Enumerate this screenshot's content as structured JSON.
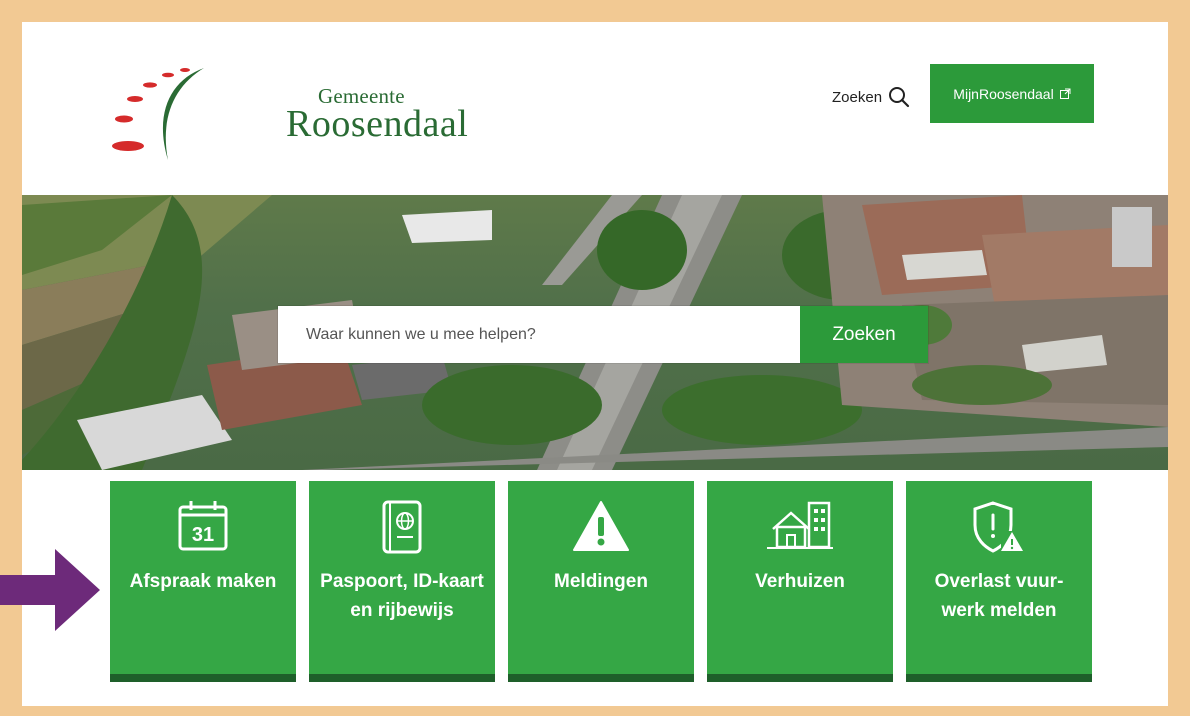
{
  "header": {
    "logo_small": "Gemeente",
    "logo_big": "Roosendaal",
    "search_label": "Zoeken",
    "mijn_label": "MijnRoosendaal"
  },
  "hero": {
    "search_placeholder": "Waar kunnen we u mee helpen?",
    "search_button": "Zoeken"
  },
  "tiles": [
    {
      "label": "Afspraak maken",
      "icon": "calendar-icon",
      "calendar_day": "31"
    },
    {
      "label": "Paspoort, ID-kaart en rijbewijs",
      "icon": "passport-icon"
    },
    {
      "label": "Meldingen",
      "icon": "warning-icon"
    },
    {
      "label": "Verhuizen",
      "icon": "buildings-icon"
    },
    {
      "label": "Overlast vuur-werk melden",
      "icon": "shield-warning-icon"
    }
  ],
  "colors": {
    "brand_green": "#2c9a3a",
    "tile_green": "#35a745",
    "tile_border": "#1e5f2a",
    "frame": "#f2c993",
    "logo_red": "#d52b2b",
    "arrow": "#6d2a7a"
  }
}
